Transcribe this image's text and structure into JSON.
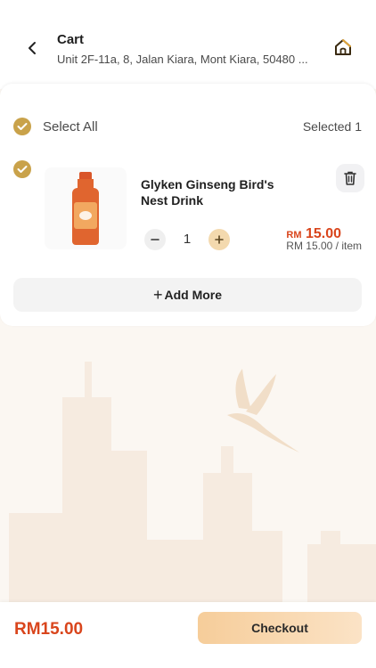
{
  "header": {
    "title": "Cart",
    "address": "Unit 2F-11a, 8, Jalan Kiara, Mont Kiara, 50480 ..."
  },
  "select_all": {
    "label": "Select All",
    "selected_text": "Selected 1"
  },
  "cart_item": {
    "name": "Glyken Ginseng Bird's Nest Drink",
    "quantity": "1",
    "price_currency": "RM",
    "price_amount": "15.00",
    "unit_price": "RM 15.00 / item"
  },
  "add_more_label": "Add More",
  "footer": {
    "total": "RM15.00",
    "checkout_label": "Checkout"
  },
  "colors": {
    "accent": "#c9a24a",
    "price": "#d9451c",
    "checkout_start": "#f6cd9a",
    "checkout_end": "#fbe3c6",
    "background": "#fbf7f2"
  }
}
